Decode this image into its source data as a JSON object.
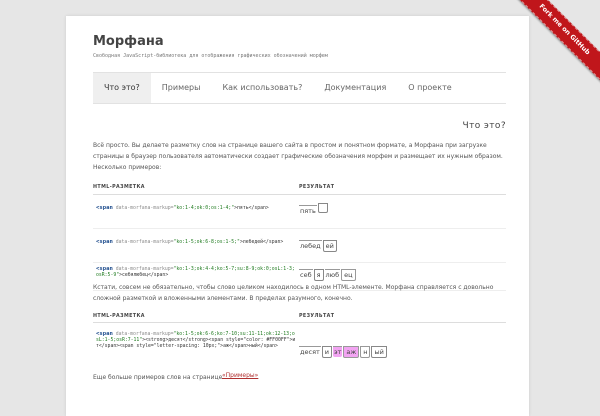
{
  "ribbon": {
    "label": "Fork me on GitHub"
  },
  "site": {
    "title": "Морфана",
    "subtitle": "Свободная JavaScript-библиотека для отображения графических обозначений морфем"
  },
  "nav": [
    {
      "label": "Что это?",
      "active": true
    },
    {
      "label": "Примеры",
      "active": false
    },
    {
      "label": "Как использовать?",
      "active": false
    },
    {
      "label": "Документация",
      "active": false
    },
    {
      "label": "О проекте",
      "active": false
    }
  ],
  "main": {
    "heading": "Что это?",
    "intro": "Всё просто. Вы делаете разметку слов на странице вашего сайта в простом и понятном формате, а Морфана при загрузке страницы в браузер пользователя автоматически создает графические обозначения морфем и размещает их нужным образом. Несколько примеров:",
    "table1": {
      "col1": "HTML-РАЗМЕТКА",
      "col2": "РЕЗУЛЬТАТ",
      "rows": [
        {
          "tag_open": "<span",
          "attr": " data-morfana-markup=",
          "val": "\"ko:1-4;ok:0;os:1-4;\"",
          "text": ">пять</span>",
          "morph": [
            "пять",
            ""
          ]
        },
        {
          "tag_open": "<span",
          "attr": " data-morfana-markup=",
          "val": "\"ko:1-5;ok:6-8;os:1-5;\"",
          "text": ">лебедей</span>",
          "morph": [
            "лебед",
            "ей"
          ]
        },
        {
          "tag_open": "<span",
          "attr": " data-morfana-markup=",
          "val": "\"ko:1-3;ok:4-4;ko:5-7;su:8-9;ok:0;osL:1-3;osR:5-9\"",
          "text": ">себялюбец</span>",
          "morph": [
            "себ",
            "я",
            "люб",
            "ец"
          ]
        }
      ]
    },
    "middle": "Кстати, совсем не обязательно, чтобы слово целиком находилось в одном HTML-элементе. Морфана справляется с довольно сложной разметкой и вложенными элементами. В пределах разумного, конечно.",
    "table2": {
      "col1": "HTML-РАЗМЕТКА",
      "col2": "РЕЗУЛЬТАТ",
      "row": {
        "tag_open": "<span",
        "attr": " data-morfana-markup=",
        "val": "\"ko:1-5;ok:6-6;ko:7-10;su:11-11;ok:12-13;osL:1-5;osR:7-11\"",
        "text": "><strong>десят</strong><span style=\"color: #FF00FF\">ит</span><span style=\"letter-spacing: 10px;\">аж</span>ный</span>",
        "morph": [
          "десят",
          "и",
          "эт",
          "аж",
          "н",
          "ый"
        ]
      }
    },
    "footer": {
      "text": "Еще больше примеров слов на странице",
      "link": "«Примеры»"
    }
  }
}
